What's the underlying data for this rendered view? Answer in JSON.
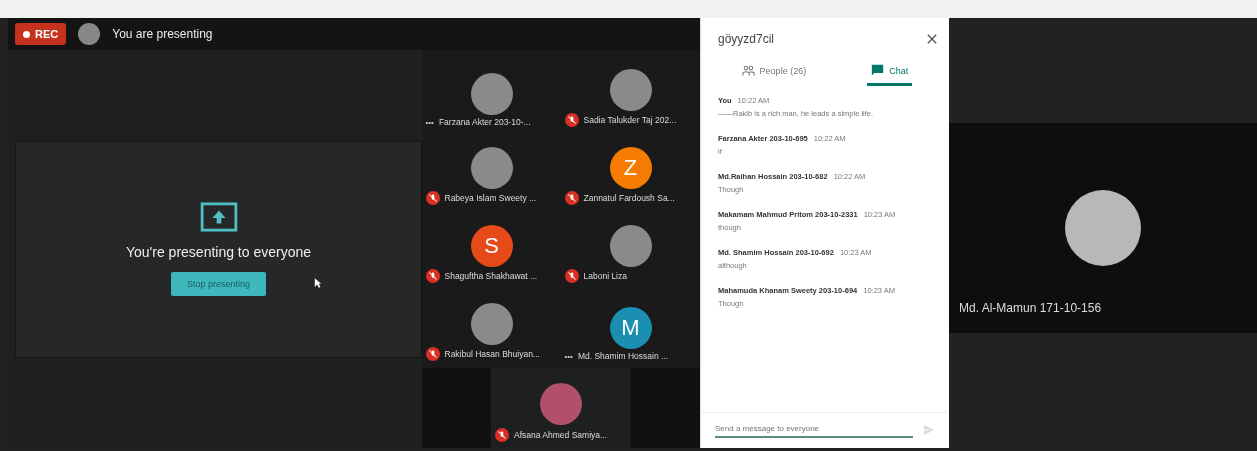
{
  "top_bar": {
    "rec_label": "REC",
    "presenting_label": "You are presenting"
  },
  "presentation": {
    "message": "You're presenting to everyone",
    "button": "Stop presenting"
  },
  "participants": [
    {
      "name": "Farzana Akter 203-10-...",
      "kind": "photo",
      "muted": false,
      "options_text": "•••"
    },
    {
      "name": "Sadia Talukder Taj 202...",
      "kind": "photo",
      "muted": true
    },
    {
      "name": "Rabeya Islam Sweety ...",
      "kind": "photo",
      "muted": true
    },
    {
      "name": "Zannatul Fardoush Sa...",
      "kind": "letter",
      "letter": "Z",
      "color": "#f57c00",
      "muted": true
    },
    {
      "name": "Shaguftha Shakhawat ...",
      "kind": "letter",
      "letter": "S",
      "color": "#e64a19",
      "muted": true
    },
    {
      "name": "Laboni Liza",
      "kind": "photo",
      "muted": true
    },
    {
      "name": "Rakibul Hasan Bhuiyan...",
      "kind": "photo",
      "muted": true
    },
    {
      "name": "Md. Shamim Hossain ...",
      "kind": "letter",
      "letter": "M",
      "color": "#1a8fb0",
      "muted": false,
      "options_text": "•••"
    }
  ],
  "bottom_participant": {
    "name": "Afsana Ahmed Samiya...",
    "kind": "photo",
    "muted": true
  },
  "chat_panel": {
    "meeting_code": "göyyzd7cil",
    "tabs": [
      {
        "label": "People (26)",
        "kind": "people",
        "selected": false
      },
      {
        "label": "Chat",
        "kind": "chat",
        "selected": true
      }
    ],
    "messages": [
      {
        "sender": "You",
        "time": "10:22 AM",
        "text": "——Rakib is a rich man, he leads a simple life."
      },
      {
        "sender": "Farzana Akter 203-10-695",
        "time": "10:22 AM",
        "text": "if"
      },
      {
        "sender": "Md.Raihan Hossain 203-10-682",
        "time": "10:22 AM",
        "text": "Though"
      },
      {
        "sender": "Makamam Mahmud Pritom 203-10-2331",
        "time": "10:23 AM",
        "text": "though"
      },
      {
        "sender": "Md. Shamim Hossain 203-10-692",
        "time": "10:23 AM",
        "text": "although"
      },
      {
        "sender": "Mahamuda Khanam Sweety 203-10-694",
        "time": "10:23 AM",
        "text": "Though"
      }
    ],
    "input_placeholder": "Send a message to everyone"
  },
  "side_tile": {
    "name": "Md. Al-Mamun 171-10-156"
  }
}
